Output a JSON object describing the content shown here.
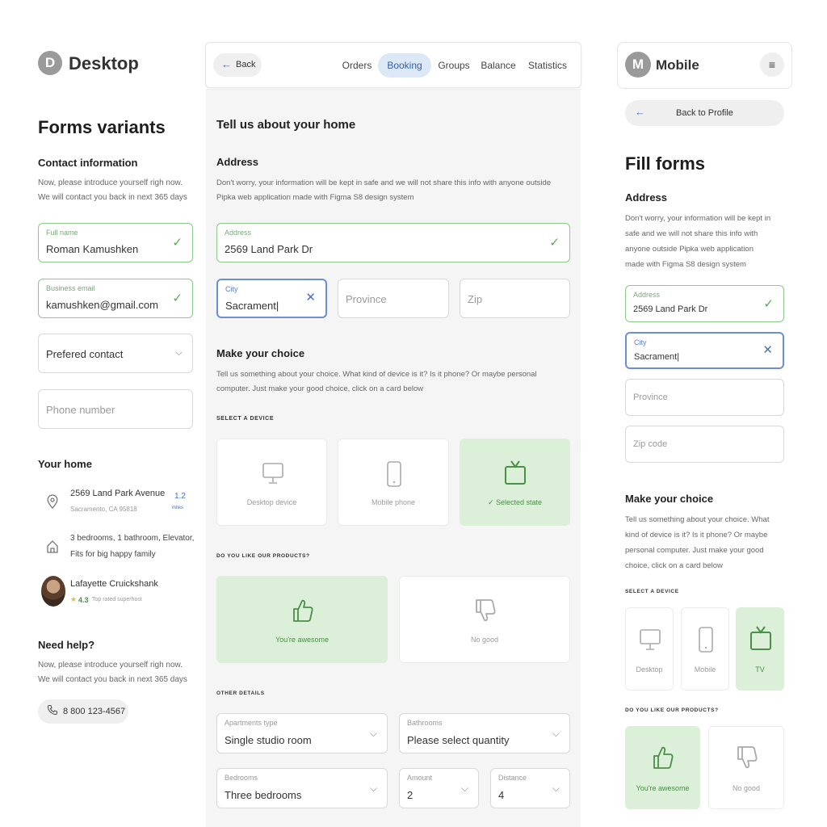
{
  "desktop": {
    "logo_letter": "D",
    "logo_title": "Desktop",
    "title": "Forms variants",
    "contact": {
      "heading": "Contact information",
      "desc_line1": "Now, please introduce yourself righ now.",
      "desc_line2": "We will contact you back in next 365 days",
      "fullname_label": "Full name",
      "fullname_value": "Roman Kamushken",
      "email_label": "Business email",
      "email_value": "kamushken@gmail.com",
      "pref_contact": "Prefered contact",
      "phone_placeholder": "Phone number"
    },
    "home": {
      "heading": "Your home",
      "address_line1": "2569 Land Park Avenue",
      "address_line2": "Sacramento, CA 95818",
      "distance_value": "1.2",
      "distance_unit": "miles",
      "rooms_line1": "3 bedrooms, 1 bathroom, Elevator,",
      "rooms_line2": "Fits for big happy family",
      "host_name": "Lafayette Cruickshank",
      "host_rating": "4.3",
      "host_status": "Top rated superhost"
    },
    "help": {
      "heading": "Need help?",
      "desc_line1": "Now, please introduce yourself righ now.",
      "desc_line2": "We will contact you back in next 365 days",
      "phone": "8 800 123-4567"
    }
  },
  "booking": {
    "back_label": "Back",
    "tabs": [
      "Orders",
      "Booking",
      "Groups",
      "Balance",
      "Statistics"
    ],
    "active_tab": "Booking",
    "title": "Tell us about your home",
    "address_heading": "Address",
    "address_desc_line1": "Don't worry, your information will be kept in safe and we will not share this info with anyone outside",
    "address_desc_line2": "Pipka web application made with Figma S8 design system",
    "address_label": "Address",
    "address_value": "2569 Land Park Dr",
    "city_label": "City",
    "city_value": "Sacrament|",
    "province_placeholder": "Province",
    "zip_placeholder": "Zip",
    "choice_heading": "Make your choice",
    "choice_desc_line1": "Tell us something about your choice. What kind of device is it? Is it phone? Or maybe personal",
    "choice_desc_line2": "computer. Just make your good choice, click on a card below",
    "select_device_label": "SELECT A DEVICE",
    "device_cards": [
      "Desktop device",
      "Mobile phone",
      "✓ Selected state"
    ],
    "products_label": "DO YOU LIKE OUR PRODUCTS?",
    "like_cards": [
      "You're awesome",
      "No good"
    ],
    "other_label": "OTHER DETAILS",
    "apt_label": "Apartments type",
    "apt_value": "Single studio room",
    "bath_label": "Bathrooms",
    "bath_value": "Please select quantity",
    "bed_label": "Bedrooms",
    "bed_value": "Three bedrooms",
    "amount_label": "Amount",
    "amount_value": "2",
    "distance_label": "Distance",
    "distance_value": "4"
  },
  "mobile": {
    "logo_letter": "M",
    "logo_title": "Mobile",
    "back_label": "Back to Profile",
    "title": "Fill forms",
    "address_heading": "Address",
    "address_desc": [
      "Don't worry, your information will be kept in",
      "safe and we will not share this info with",
      "anyone outside Pipka web application",
      "made with Figma S8 design system"
    ],
    "address_label": "Address",
    "address_value": "2569 Land Park Dr",
    "city_label": "City",
    "city_value": "Sacrament|",
    "province_placeholder": "Province",
    "zip_placeholder": "Zip code",
    "choice_heading": "Make your choice",
    "choice_desc": [
      "Tell us something about your choice. What",
      "kind of device is it? Is it phone? Or maybe",
      "personal computer. Just make your good",
      "choice, click on a card below"
    ],
    "select_device_label": "SELECT A DEVICE",
    "device_cards": [
      "Desktop",
      "Mobile",
      "TV"
    ],
    "products_label": "DO YOU LIKE OUR PRODUCTS?",
    "like_cards": [
      "You're awesome",
      "No good"
    ]
  },
  "colors": {
    "accent_green": "#5aa857",
    "selected_bg": "#dcefd9",
    "accent_blue": "#4a72c4",
    "panel_bg": "#f5f5f5"
  }
}
